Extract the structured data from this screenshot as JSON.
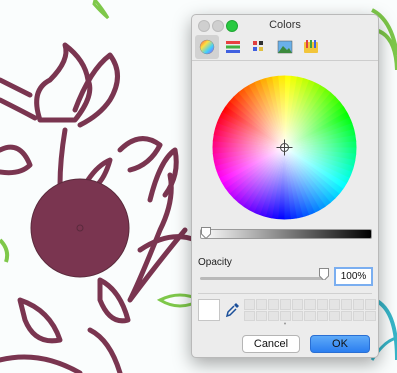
{
  "window": {
    "title": "Colors"
  },
  "toolbar": {
    "tools": [
      {
        "icon": "color-wheel-icon",
        "selected": true
      },
      {
        "icon": "color-sliders-icon",
        "selected": false
      },
      {
        "icon": "color-palettes-icon",
        "selected": false
      },
      {
        "icon": "image-palettes-icon",
        "selected": false
      },
      {
        "icon": "pencils-icon",
        "selected": false
      }
    ]
  },
  "color_wheel": {
    "brightness_level": 0.0
  },
  "opacity": {
    "label": "Opacity",
    "value": "100%",
    "level": 1.0
  },
  "current_color": "#ffffff",
  "buttons": {
    "cancel": "Cancel",
    "ok": "OK"
  },
  "colors": {
    "accent": "#2b7ef0",
    "canvas_background": "#fafdfd",
    "flower_main": "#7a3550",
    "leaf_green": "#7ec84a",
    "teal": "#37b5c8"
  }
}
